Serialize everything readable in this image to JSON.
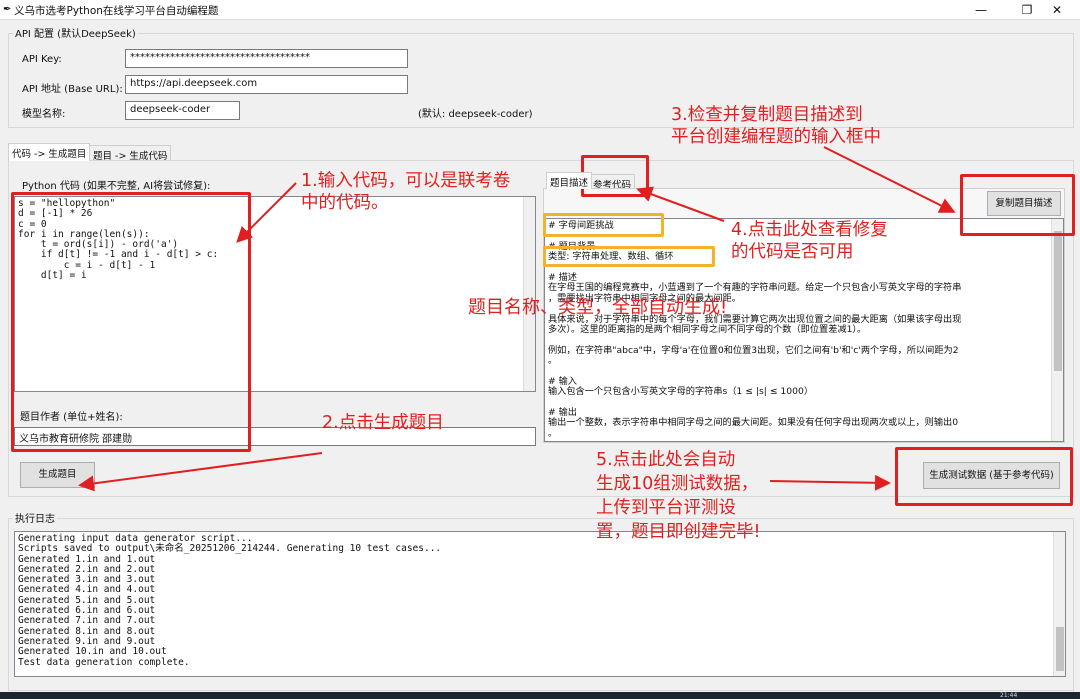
{
  "window": {
    "title": "义乌市选考Python在线学习平台自动编程题",
    "minimize": "—",
    "restore": "❐",
    "close": "✕"
  },
  "api": {
    "group_title": "API 配置 (默认DeepSeek)",
    "key_label": "API Key:",
    "key_value": "************************************",
    "url_label": "API 地址 (Base URL):",
    "url_value": "https://api.deepseek.com",
    "model_label": "模型名称:",
    "model_value": "deepseek-coder",
    "model_hint": "(默认: deepseek-coder)"
  },
  "main_tabs": [
    "代码 -> 生成题目",
    "题目 -> 生成代码"
  ],
  "code_panel": {
    "label": "Python 代码 (如果不完整, AI将尝试修复):",
    "code": "s = \"hellopython\"\nd = [-1] * 26\nc = 0\nfor i in range(len(s)):\n    t = ord(s[i]) - ord('a')\n    if d[t] != -1 and i - d[t] > c:\n        c = i - d[t] - 1\n    d[t] = i",
    "author_label": "题目作者 (单位+姓名):",
    "author_value": "义乌市教育研修院 邵建勋",
    "generate_button": "生成题目"
  },
  "result_panel": {
    "tabs": [
      "题目描述",
      "参考代码"
    ],
    "copy_button": "复制题目描述",
    "lines": [
      "# 字母间距挑战",
      "",
      "# 题目背景",
      "类型: 字符串处理、数组、循环",
      "",
      "# 描述",
      "在字母王国的编程竞赛中，小蓝遇到了一个有趣的字符串问题。给定一个只包含小写英文字母的字符串",
      "，需要找出字符串中相同字母之间的最大间距。",
      "",
      "具体来说，对于字符串中的每个字母，我们需要计算它两次出现位置之间的最大距离（如果该字母出现",
      "多次）。这里的距离指的是两个相同字母之间不同字母的个数（即位置差减1）。",
      "",
      "例如，在字符串\"abca\"中，字母'a'在位置0和位置3出现，它们之间有'b'和'c'两个字母，所以间距为2",
      "。",
      "",
      "# 输入",
      "输入包含一个只包含小写英文字母的字符串s（1 ≤ |s| ≤ 1000）",
      "",
      "# 输出",
      "输出一个整数，表示字符串中相同字母之间的最大间距。如果没有任何字母出现两次或以上，则输出0",
      "。"
    ],
    "testdata_button": "生成测试数据 (基于参考代码)"
  },
  "log": {
    "title": "执行日志",
    "text": "Generating input data generator script...\nScripts saved to output\\未命名_20251206_214244. Generating 10 test cases...\nGenerated 1.in and 1.out\nGenerated 2.in and 2.out\nGenerated 3.in and 3.out\nGenerated 4.in and 4.out\nGenerated 5.in and 5.out\nGenerated 6.in and 6.out\nGenerated 7.in and 7.out\nGenerated 8.in and 8.out\nGenerated 9.in and 9.out\nGenerated 10.in and 10.out\nTest data generation complete."
  },
  "annotations": {
    "step1": "1.输入代码，可以是联考卷\n中的代码。",
    "step2": "2.点击生成题目",
    "step3": "3.检查并复制题目描述到\n平台创建编程题的输入框中",
    "step4": "4.点击此处查看修复\n的代码是否可用",
    "step5": "5.点击此处会自动\n生成10组测试数据，\n上传到平台评测设\n置，题目即创建完毕!",
    "center": "题目名称、类型，全部自动生成!"
  },
  "taskbar_clock": "21:44",
  "colors": {
    "annotation": "#e02020",
    "highlight": "#f2b22e"
  }
}
